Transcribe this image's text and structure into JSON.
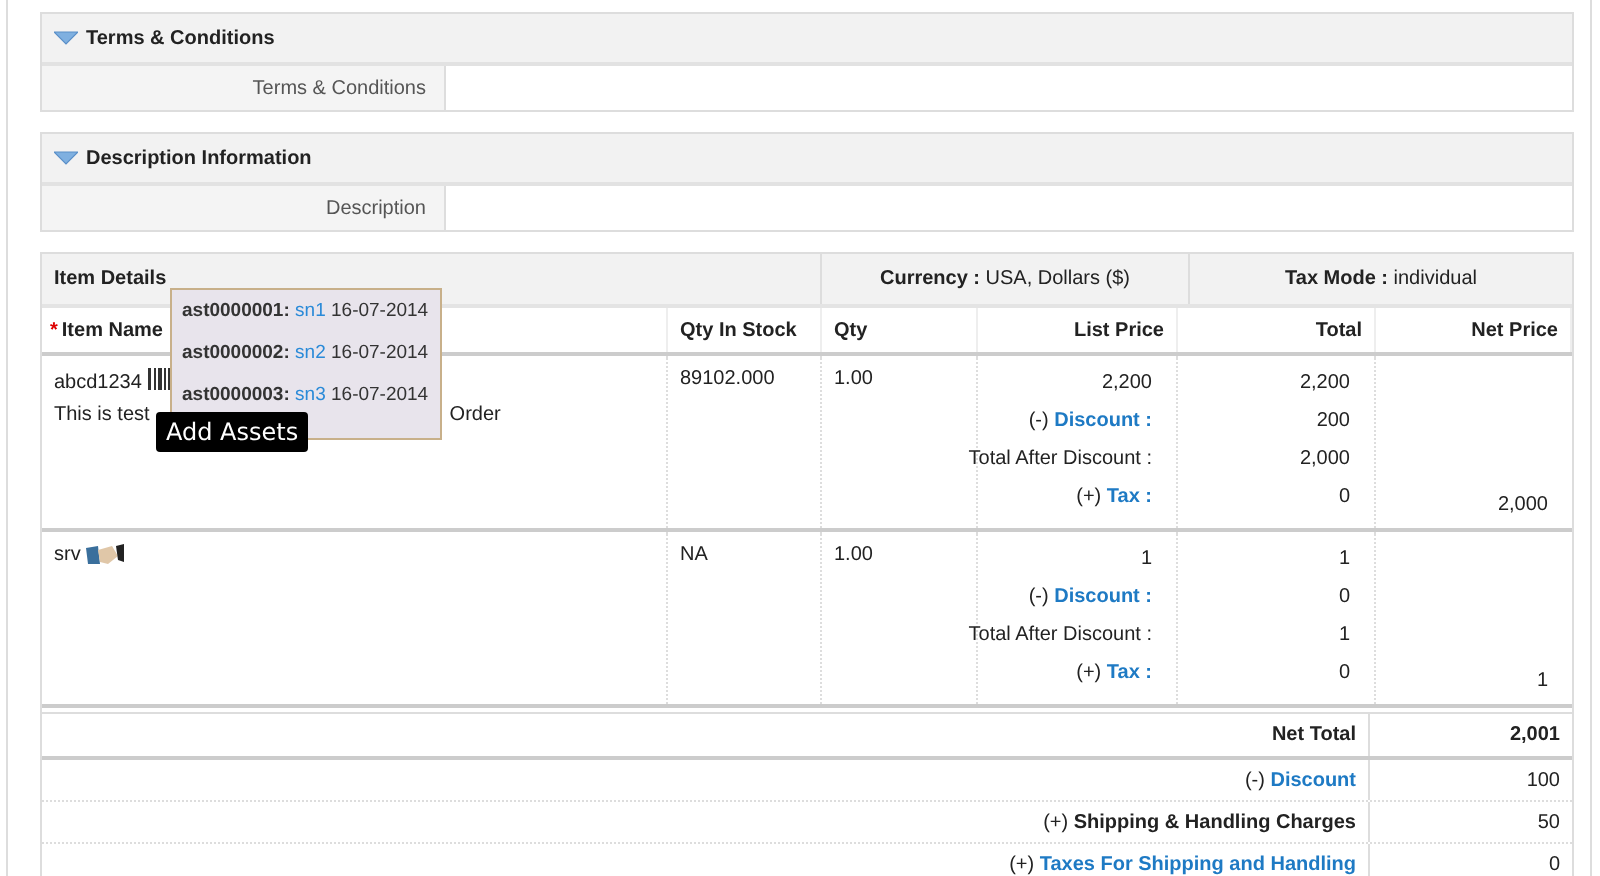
{
  "sections": [
    {
      "title": "Terms & Conditions",
      "field_label": "Terms & Conditions"
    },
    {
      "title": "Description Information",
      "field_label": "Description"
    }
  ],
  "items": {
    "title": "Item Details",
    "currency_label": "Currency :",
    "currency": "USA, Dollars ($)",
    "tax_mode_label": "Tax Mode :",
    "tax_mode": "individual",
    "columns": [
      {
        "label": "Item Name",
        "required_mark": "*"
      },
      {
        "label": "Qty In Stock"
      },
      {
        "label": "Qty"
      },
      {
        "label": "List Price"
      },
      {
        "label": "Total"
      },
      {
        "label": "Net Price"
      }
    ],
    "rows": [
      {
        "name": "abcd1234",
        "kind": "product",
        "comment_parts": [
          "This is test",
          "Order"
        ],
        "qty_in_stock": "89102.000",
        "qty": "1.00",
        "list_price": "2,200",
        "total": "2,200",
        "breakdown": [
          {
            "prefix": "(-)",
            "label": "Discount :",
            "kind": "link",
            "value": "200"
          },
          {
            "label": "Total After Discount :",
            "kind": "plain",
            "value": "2,000"
          },
          {
            "prefix": "(+)",
            "label": "Tax :",
            "kind": "link",
            "value": "0"
          }
        ],
        "net_price": "2,000"
      },
      {
        "name": "srv",
        "kind": "service",
        "qty_in_stock": "NA",
        "qty": "1.00",
        "list_price": "1",
        "total": "1",
        "breakdown": [
          {
            "prefix": "(-)",
            "label": "Discount :",
            "kind": "link",
            "value": "0"
          },
          {
            "label": "Total After Discount :",
            "kind": "plain",
            "value": "1"
          },
          {
            "prefix": "(+)",
            "label": "Tax :",
            "kind": "link",
            "value": "0"
          }
        ],
        "net_price": "1"
      }
    ],
    "totals": [
      {
        "label": "Net Total",
        "kind": "total",
        "value": "2,001"
      },
      {
        "prefix": "(-)",
        "label": "Discount",
        "kind": "link",
        "value": "100"
      },
      {
        "prefix": "(+)",
        "label": "Shipping & Handling Charges",
        "kind": "bold",
        "value": "50"
      },
      {
        "prefix": "(+)",
        "label": "Taxes For Shipping and Handling",
        "kind": "link",
        "value": "0"
      }
    ]
  },
  "asset_popover": {
    "assets": [
      {
        "id": "ast0000001:",
        "serial": "sn1",
        "date": "16-07-2014"
      },
      {
        "id": "ast0000002:",
        "serial": "sn2",
        "date": "16-07-2014"
      },
      {
        "id": "ast0000003:",
        "serial": "sn3",
        "date": "16-07-2014"
      }
    ],
    "tooltip": "Add Assets"
  }
}
